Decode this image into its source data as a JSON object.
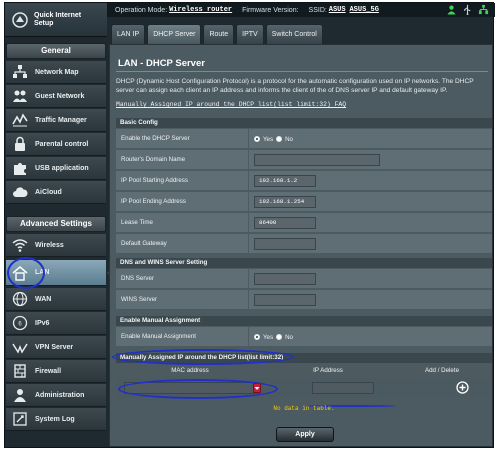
{
  "topbar": {
    "mode_label": "Operation Mode:",
    "mode_value": "Wireless router",
    "firmware_label": "Firmware Version:",
    "ssid_label": "SSID:",
    "ssid_1": "ASUS",
    "ssid_2": "ASUS_5G",
    "icons": [
      "user-icon",
      "usb-icon",
      "network-icon"
    ]
  },
  "sidebar": {
    "quick_setup": "Quick Internet\nSetup",
    "general_heading": "General",
    "general_items": [
      {
        "label": "Network Map",
        "icon": "network-map-icon"
      },
      {
        "label": "Guest Network",
        "icon": "guest-network-icon"
      },
      {
        "label": "Traffic Manager",
        "icon": "traffic-manager-icon"
      },
      {
        "label": "Parental control",
        "icon": "lock-icon"
      },
      {
        "label": "USB application",
        "icon": "puzzle-icon"
      },
      {
        "label": "AiCloud",
        "icon": "cloud-icon"
      }
    ],
    "advanced_heading": "Advanced Settings",
    "advanced_items": [
      {
        "label": "Wireless",
        "icon": "wifi-icon"
      },
      {
        "label": "LAN",
        "icon": "home-icon",
        "active": true
      },
      {
        "label": "WAN",
        "icon": "globe-icon"
      },
      {
        "label": "IPv6",
        "icon": "ipv6-icon"
      },
      {
        "label": "VPN Server",
        "icon": "vpn-icon"
      },
      {
        "label": "Firewall",
        "icon": "firewall-icon"
      },
      {
        "label": "Administration",
        "icon": "administration-icon"
      },
      {
        "label": "System Log",
        "icon": "system-log-icon"
      }
    ]
  },
  "tabs": [
    {
      "label": "LAN IP"
    },
    {
      "label": "DHCP Server",
      "active": true
    },
    {
      "label": "Route"
    },
    {
      "label": "IPTV"
    },
    {
      "label": "Switch Control"
    }
  ],
  "main": {
    "title": "LAN - DHCP Server",
    "description": "DHCP (Dynamic Host Configuration Protocol) is a protocol for the automatic configuration used on IP networks. The DHCP server can assign each client an IP address and informs the client of the of DNS server IP and default gateway IP.",
    "faq_link": "Manually Assigned IP around the DHCP list(list limit:32) FAQ",
    "basic_config": {
      "heading": "Basic Config",
      "enable_label": "Enable the DHCP Server",
      "enable_options": [
        "Yes",
        "No"
      ],
      "enable_selected": "Yes",
      "domain_label": "Router's Domain Name",
      "domain_value": "",
      "start_label": "IP Pool Starting Address",
      "start_value": "192.168.1.2",
      "end_label": "IP Pool Ending Address",
      "end_value": "192.168.1.254",
      "lease_label": "Lease Time",
      "lease_value": "86400",
      "gateway_label": "Default Gateway",
      "gateway_value": ""
    },
    "dns_wins": {
      "heading": "DNS and WINS Server Setting",
      "dns_label": "DNS Server",
      "dns_value": "",
      "wins_label": "WINS Server",
      "wins_value": ""
    },
    "manual": {
      "heading": "Enable Manual Assignment",
      "enable_label": "Enable Manual Assignment",
      "options": [
        "Yes",
        "No"
      ],
      "selected": "Yes"
    },
    "manual_list": {
      "heading": "Manually Assigned IP around the DHCP list(list limit:32)",
      "col_mac": "MAC address",
      "col_ip": "IP Address",
      "col_action": "Add / Delete",
      "mac_value": "",
      "ip_value": "",
      "no_data": "No data in table."
    },
    "apply_label": "Apply"
  }
}
